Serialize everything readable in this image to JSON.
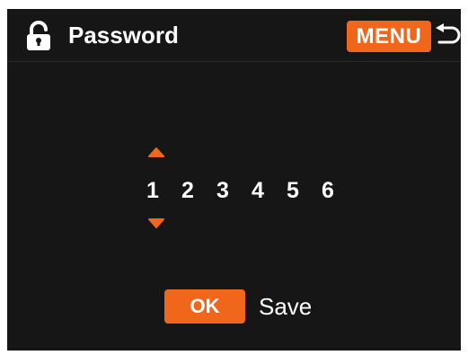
{
  "header": {
    "title": "Password",
    "menu_label": "MENU",
    "lock_icon": "lock-icon",
    "back_icon": "back-arrow-icon"
  },
  "password": {
    "digits": [
      "1",
      "2",
      "3",
      "4",
      "5",
      "6"
    ],
    "selected_index": 0,
    "increment_icon": "caret-up-icon",
    "decrement_icon": "caret-down-icon"
  },
  "footer": {
    "ok_label": "OK",
    "save_label": "Save"
  },
  "colors": {
    "accent": "#f0661a",
    "background": "#161616",
    "text": "#ffffff"
  }
}
